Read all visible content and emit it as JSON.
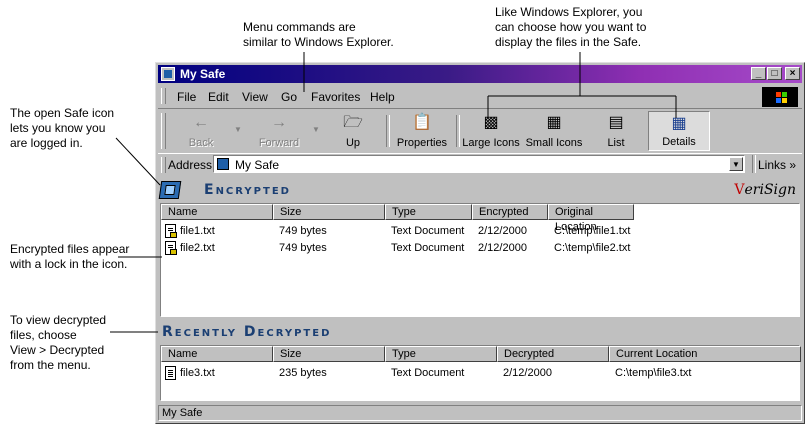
{
  "annotations": {
    "menu_commands": "Menu commands are\nsimilar to Windows Explorer.",
    "view_files": "Like Windows Explorer, you\ncan choose how you want to\ndisplay the files in the Safe.",
    "open_safe": "The open Safe icon\nlets you know you\nare logged in.",
    "encrypted_lock": "Encrypted files appear\nwith a lock in the icon.",
    "view_decrypted": "To view decrypted\nfiles, choose\nView > Decrypted\nfrom the menu."
  },
  "window": {
    "title": "My Safe",
    "controls": {
      "minimize": "_",
      "maximize": "□",
      "close": "×"
    }
  },
  "menu": [
    "File",
    "Edit",
    "View",
    "Go",
    "Favorites",
    "Help"
  ],
  "toolbar": {
    "back": "Back",
    "forward": "Forward",
    "up": "Up",
    "properties": "Properties",
    "large_icons": "Large Icons",
    "small_icons": "Small Icons",
    "list": "List",
    "details": "Details"
  },
  "address": {
    "label": "Address",
    "value": "My Safe",
    "links": "Links"
  },
  "encrypted": {
    "title": "Encrypted",
    "brand": "eriSign",
    "brand_mark": "V",
    "columns": [
      "Name",
      "Size",
      "Type",
      "Encrypted",
      "Original Location"
    ],
    "rows": [
      [
        "file1.txt",
        "749 bytes",
        "Text Document",
        "2/12/2000",
        "C:\\temp\\file1.txt"
      ],
      [
        "file2.txt",
        "749 bytes",
        "Text Document",
        "2/12/2000",
        "C:\\temp\\file2.txt"
      ]
    ]
  },
  "decrypted": {
    "title": "Recently Decrypted",
    "columns": [
      "Name",
      "Size",
      "Type",
      "Decrypted",
      "Current Location"
    ],
    "rows": [
      [
        "file3.txt",
        "235 bytes",
        "Text Document",
        "2/12/2000",
        "C:\\temp\\file3.txt"
      ]
    ]
  },
  "status": {
    "text": "My Safe"
  }
}
